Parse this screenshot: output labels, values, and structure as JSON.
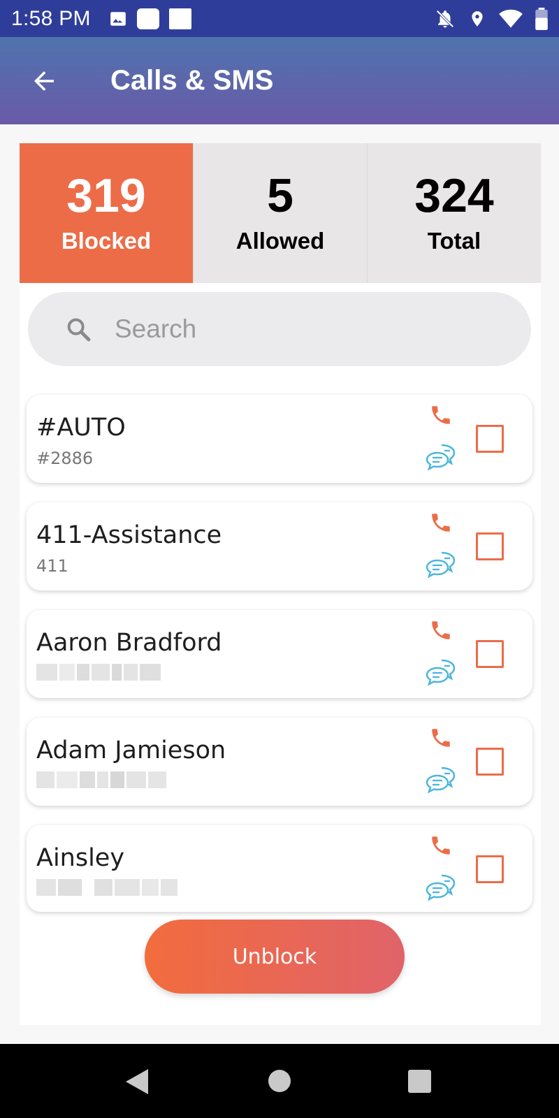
{
  "status_bar": {
    "time": "1:58 PM",
    "icons": [
      "image-icon",
      "app-icon",
      "app-icon",
      "bell-off-icon",
      "location-icon",
      "wifi-icon",
      "battery-icon"
    ]
  },
  "app_bar": {
    "title": "Calls & SMS",
    "back_icon": "arrow-left-icon"
  },
  "stats": [
    {
      "value": "319",
      "label": "Blocked",
      "active": true
    },
    {
      "value": "5",
      "label": "Allowed",
      "active": false
    },
    {
      "value": "324",
      "label": "Total",
      "active": false
    }
  ],
  "search": {
    "placeholder": "Search",
    "value": ""
  },
  "contacts": [
    {
      "name": "#AUTO",
      "number": "#2886",
      "number_hidden": false,
      "checked": false
    },
    {
      "name": "411-Assistance",
      "number": "411",
      "number_hidden": false,
      "checked": false
    },
    {
      "name": "Aaron Bradford",
      "number": "",
      "number_hidden": true,
      "checked": false
    },
    {
      "name": "Adam Jamieson",
      "number": "",
      "number_hidden": true,
      "checked": false
    },
    {
      "name": "Ainsley",
      "number": "",
      "number_hidden": true,
      "checked": false
    }
  ],
  "unblock_button": "Unblock",
  "colors": {
    "accent": "#ec6c48",
    "sms_icon": "#4bb6dc",
    "status_bar": "#2f3d9a",
    "app_bar_start": "#4f73ad",
    "app_bar_end": "#6a5aa8"
  }
}
